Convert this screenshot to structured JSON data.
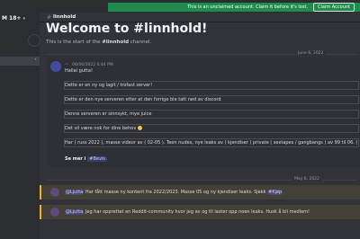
{
  "banner": {
    "text": "This is an unclaimed account. Claim it before it's lost.",
    "button": "Claim Account"
  },
  "sidebar": {
    "server_name": "M 18+",
    "chevron": "▾",
    "row_icon": "add-user-icon"
  },
  "channel": {
    "name": "linnhold",
    "hash": "#"
  },
  "welcome": {
    "title": "Welcome to #linnhold!",
    "subtitle_prefix": "This is the start of the ",
    "subtitle_channel": "#linnhold",
    "subtitle_suffix": " channel."
  },
  "messages": {
    "date_1": "June 6, 2022",
    "author": "~",
    "timestamp": "06/06/2022 6:44 PM",
    "lines": [
      "Hallai gutta!",
      "Dette er en ny og lagit / trofast server!",
      "Dette er den nye serveren etter at den forrige ble tatt ned av discord",
      "Denne serveren er sinnsykt, mye juice",
      "Det vil være nok for dine behov",
      "Har ( russ 2022 ), masse videor av ( 02-05 ). Teen nudes, nye leaks av ( kjendiser ) private ( sextapes / gangbangs ) av 99 til 06. ( privat"
    ],
    "see_more": "Se mer i",
    "see_more_channel": "#Bevis",
    "date_2": "May 6, 2022",
    "highlight_1": {
      "mention": "@Ljutta",
      "text": " Har fått masse ny kontent fra 2022/2023. Masse 05 og ny kjendiser leaks. Sjekk ",
      "channel": "#Kjøp"
    },
    "highlight_2": {
      "mention": "@Ljutta",
      "text": " Jeg har opprettet en Reddit-community hvor jeg av og til laster opp noen leaks. Husk å bli medlem!"
    }
  }
}
